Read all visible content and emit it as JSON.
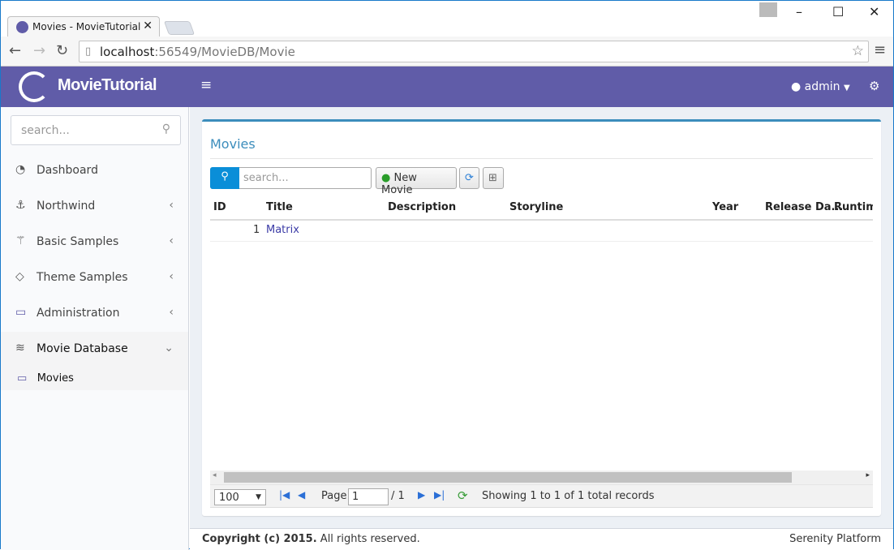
{
  "browser": {
    "tab_title": "Movies - MovieTutorial",
    "url_host": "localhost",
    "url_rest": ":56549/MovieDB/Movie"
  },
  "header": {
    "brand": "MovieTutorial",
    "user": "admin"
  },
  "sidebar": {
    "search_placeholder": "search...",
    "items": [
      {
        "label": "Dashboard",
        "icon": "dashboard-icon"
      },
      {
        "label": "Northwind",
        "icon": "anchor-icon"
      },
      {
        "label": "Basic Samples",
        "icon": "magic-icon"
      },
      {
        "label": "Theme Samples",
        "icon": "diamond-icon"
      },
      {
        "label": "Administration",
        "icon": "desktop-icon"
      },
      {
        "label": "Movie Database",
        "icon": "layers-icon"
      }
    ],
    "sub_items": [
      {
        "label": "Movies",
        "icon": "video-icon"
      }
    ]
  },
  "main": {
    "title": "Movies",
    "search_placeholder": "search...",
    "new_button": "New Movie",
    "columns": [
      "ID",
      "Title",
      "Description",
      "Storyline",
      "Year",
      "Release Da...",
      "Runtime"
    ],
    "rows": [
      {
        "id": "1",
        "title": "Matrix"
      }
    ],
    "pager": {
      "page_size": "100",
      "page_label": "Page",
      "page": "1",
      "page_total": "/ 1",
      "status": "Showing 1 to 1 of 1 total records"
    }
  },
  "footer": {
    "copyright": "Copyright (c) 2015.",
    "rights": "All rights reserved.",
    "platform": "Serenity Platform"
  },
  "colors": {
    "header": "#605ca8",
    "accent": "#3c8dbc",
    "search_button": "#0a8ed8"
  }
}
